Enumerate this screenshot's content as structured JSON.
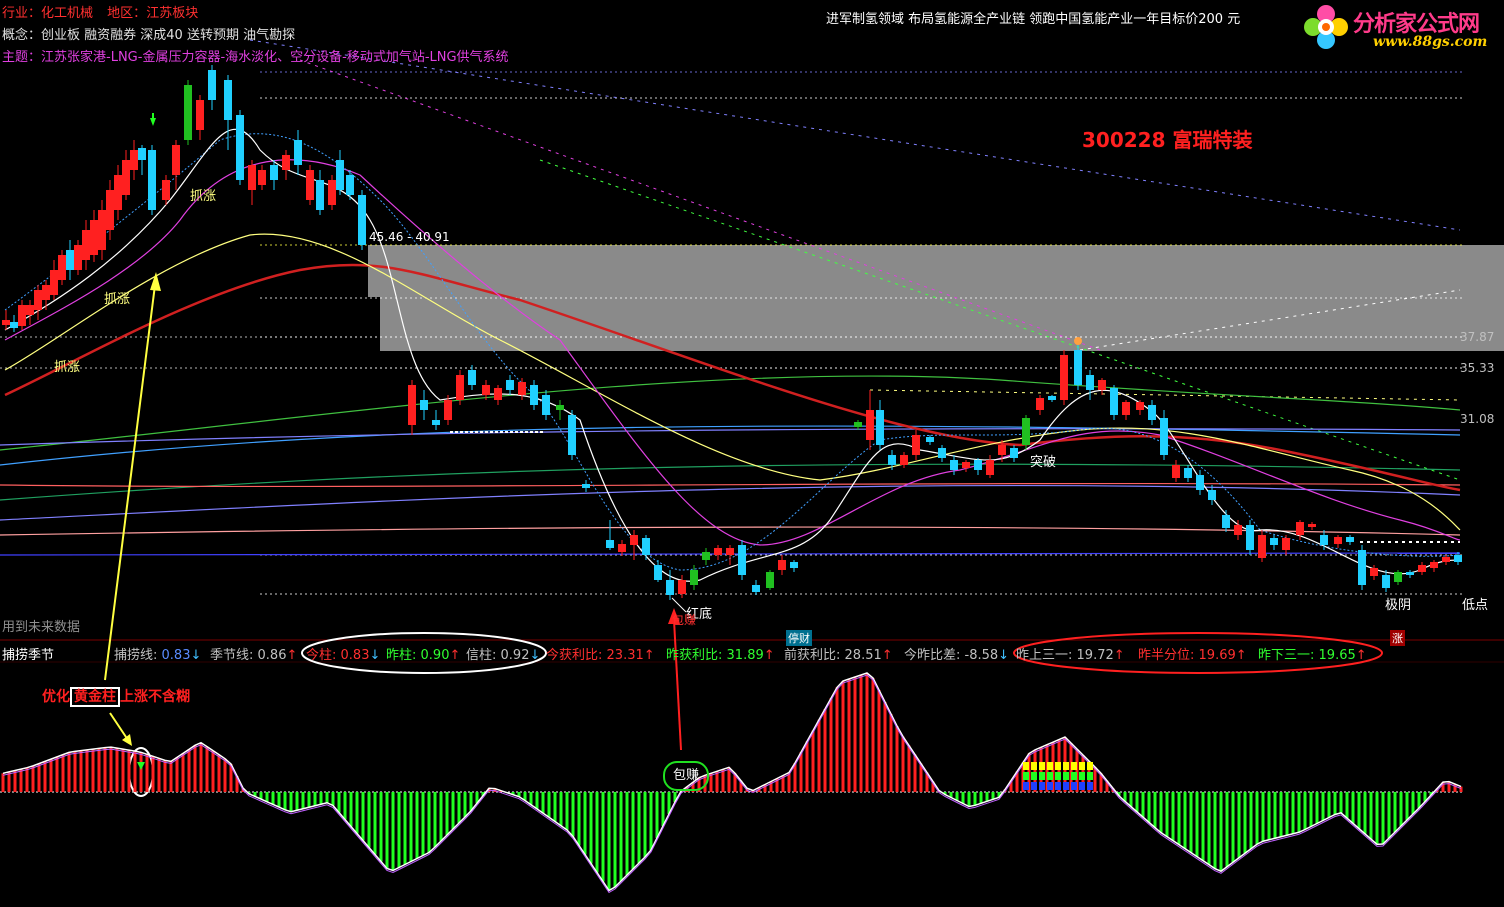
{
  "header": {
    "industry_label": "行业：",
    "industry_value": "化工机械",
    "region_label": "地区：",
    "region_value": "江苏板块",
    "concept_label": "概念：",
    "concept_value": "创业板 融资融券 深成40 送转预期 油气勘探",
    "theme_label": "主题：",
    "theme_value": "江苏张家港-LNG-金属压力容器-海水淡化、空分设备-移动式加气站-LNG供气系统",
    "news": "进军制氢领域 布局氢能源全产业链 领跑中国氢能产业一年目标价200 元"
  },
  "logo": {
    "title": "分析家公式网",
    "url": "www.88gs.com"
  },
  "stock": {
    "code_name": "300228 富瑞特装"
  },
  "price_axis": [
    "37.87",
    "35.33",
    "31.08"
  ],
  "chart_labels": {
    "range": "45.46 - 40.91",
    "grab_rise": "抓涨",
    "breakthrough": "突破",
    "red_bottom": "红底",
    "guaranteed_profit": "包赚",
    "extreme_yin": "极阴",
    "low_point": "低点",
    "future_data": "用到未来数据",
    "stop_loss": "停财",
    "up_tag": "涨"
  },
  "indicator": {
    "title": "捕捞季节",
    "items": [
      {
        "label": "捕捞线:",
        "value": "0.83",
        "arrow": "↓",
        "color": "#c0c0c0",
        "vcolor": "#5a8cff"
      },
      {
        "label": "季节线:",
        "value": "0.86",
        "arrow": "↑",
        "color": "#c0c0c0",
        "vcolor": "#c0c0c0"
      },
      {
        "label": "今柱:",
        "value": "0.83",
        "arrow": "↓",
        "color": "#ff3030",
        "vcolor": "#ff3030"
      },
      {
        "label": "昨柱:",
        "value": "0.90",
        "arrow": "↑",
        "color": "#30ff30",
        "vcolor": "#30ff30"
      },
      {
        "label": "信柱:",
        "value": "0.92",
        "arrow": "↓",
        "color": "#c0c0c0",
        "vcolor": "#c0c0c0"
      },
      {
        "label": "今获利比:",
        "value": "23.31",
        "arrow": "↑",
        "color": "#ff3030",
        "vcolor": "#ff3030"
      },
      {
        "label": "昨获利比:",
        "value": "31.89",
        "arrow": "↑",
        "color": "#30ff30",
        "vcolor": "#30ff30"
      },
      {
        "label": "前获利比:",
        "value": "28.51",
        "arrow": "↑",
        "color": "#c0c0c0",
        "vcolor": "#c0c0c0"
      },
      {
        "label": "今昨比差:",
        "value": "-8.58",
        "arrow": "↓",
        "color": "#c0c0c0",
        "vcolor": "#c0c0c0"
      },
      {
        "label": "昨上三一:",
        "value": "19.72",
        "arrow": "↑",
        "color": "#c0c0c0",
        "vcolor": "#c0c0c0"
      },
      {
        "label": "昨半分位:",
        "value": "19.69",
        "arrow": "↑",
        "color": "#ff3030",
        "vcolor": "#ff3030"
      },
      {
        "label": "昨下三一:",
        "value": "19.65",
        "arrow": "↑",
        "color": "#30ff30",
        "vcolor": "#30ff30"
      }
    ]
  },
  "annotation": {
    "note_prefix": "优化",
    "note_boxed": "黄金柱",
    "note_suffix": "上涨不含糊",
    "profit_bubble": "包赚"
  },
  "colors": {
    "up": "#ff2020",
    "down": "#20d0ff",
    "green": "#20c020",
    "yellow": "#ffff40",
    "magenta": "#e040e0",
    "grey_box": "#808080",
    "accent_red": "#ff2020"
  }
}
